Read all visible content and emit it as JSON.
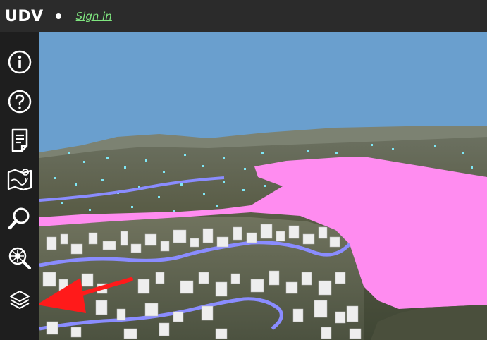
{
  "header": {
    "app_title": "UDV",
    "signin_label": "Sign in"
  },
  "sidebar": {
    "items": [
      {
        "icon": "info-icon"
      },
      {
        "icon": "help-icon"
      },
      {
        "icon": "document-icon"
      },
      {
        "icon": "map-icon"
      },
      {
        "icon": "search-icon"
      },
      {
        "icon": "search-details-icon"
      },
      {
        "icon": "layers-icon"
      }
    ]
  },
  "colors": {
    "sky": "#6a9fce",
    "overlay_pink": "#ff8cf0",
    "river_blue": "#8a8cff",
    "annotation_arrow": "#ff1a1a"
  }
}
